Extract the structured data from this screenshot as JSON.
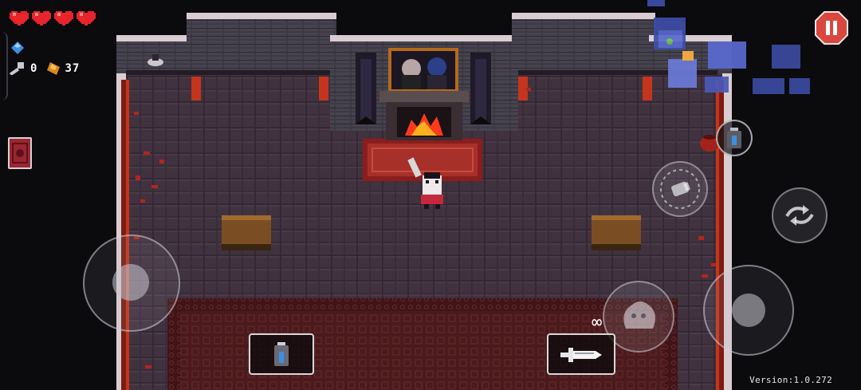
{
  "hud": {
    "hearts": [
      {
        "name": "heart-full-icon"
      },
      {
        "name": "heart-full-icon"
      },
      {
        "name": "heart-full-icon"
      },
      {
        "name": "heart-full-icon"
      }
    ],
    "keys_count": "0",
    "shells_count": "37",
    "colors": {
      "heart": "#e8242c",
      "blank": "#3d8fe0",
      "shell": "#d8861c",
      "pause": "#d9473e"
    }
  },
  "weapon": {
    "ammo": "∞",
    "icon": "sword-gun-icon"
  },
  "active_item": {
    "icon": "blank-canister-icon"
  },
  "controls": {
    "pause_icon": "pause-icon",
    "reload_icon": "reload-icon",
    "dodge_roll_icon": "dodge-roll-icon",
    "interact_icon": "interact-icon",
    "use_item_icon": "canister-icon"
  },
  "footer": {
    "version": "Version:1.0.272"
  }
}
